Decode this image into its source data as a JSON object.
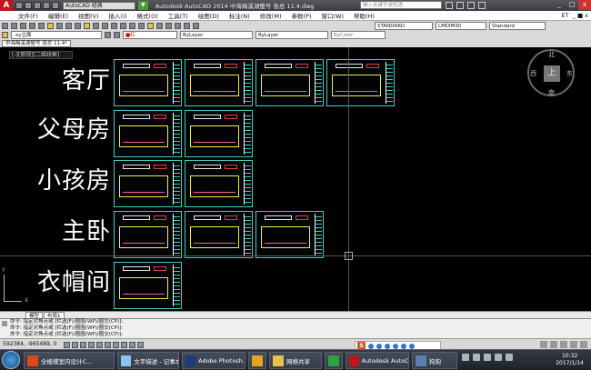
{
  "app": {
    "workspace": "AutoCAD 经典",
    "title": "Autodesk AutoCAD 2014    中海梅溪湖璧号 张总 11.4.dwg",
    "search_placeholder": "键入关键字或短语",
    "logo_letter": "A"
  },
  "menu": [
    "文件(F)",
    "编辑(E)",
    "视图(V)",
    "插入(I)",
    "格式(O)",
    "工具(T)",
    "绘图(D)",
    "标注(N)",
    "修改(M)",
    "参数(P)",
    "窗口(W)",
    "帮助(H)"
  ],
  "menu_tail": [
    "ET",
    "_ ■ x"
  ],
  "toolbar": {
    "layer_name": "-xy立面",
    "color": "■红",
    "linetype": "ByLayer",
    "lineweight": "ByLayer",
    "plotstyle": "ByColor",
    "textstyle": "STANDARD",
    "dimstyle": "LMDIM30",
    "tablestyle": "Standard"
  },
  "file_tab": "中海梅溪湖璧号 张总 11.4*",
  "viewport_label": "[-][俯视][二维线框]",
  "rooms": [
    "客厅",
    "父母房",
    "小孩房",
    "主卧",
    "衣帽间"
  ],
  "sheet_rows": [
    4,
    2,
    2,
    3,
    1
  ],
  "viewcube": {
    "center": "上",
    "n": "北",
    "s": "南",
    "e": "东",
    "w": "西"
  },
  "ucs": {
    "x": "X",
    "y": "Y"
  },
  "layout_tabs": [
    "模型",
    "布局1"
  ],
  "commands": [
    "命令: 指定对角点或 [栏选(F)/圈围(WP)/圈交(CP)]:",
    "命令: 指定对角点或 [栏选(F)/圈围(WP)/圈交(CP)]:",
    "命令: 指定对角点或 [栏选(F)/圈围(WP)/圈交(CP)]:"
  ],
  "coordinates": "592384, -965489, 0",
  "taskbar": {
    "items": [
      {
        "label": "全植蝶室内设计C...",
        "color": "#d84a1b"
      },
      {
        "label": "文字描述 - 记事本",
        "color": "#8cc4ef"
      },
      {
        "label": "Adobe Photosh...",
        "color": "#1a3d7a"
      },
      {
        "label": "",
        "color": "#e6a51c"
      },
      {
        "label": "网络共享",
        "color": "#e8c148"
      },
      {
        "label": "",
        "color": "#30a040"
      },
      {
        "label": "Autodesk AutoC...",
        "color": "#c0161b"
      },
      {
        "label": "狗狗",
        "color": "#5a7fb0"
      }
    ],
    "time": "10:32",
    "date": "2017/1/14"
  },
  "ime_logo": "S"
}
